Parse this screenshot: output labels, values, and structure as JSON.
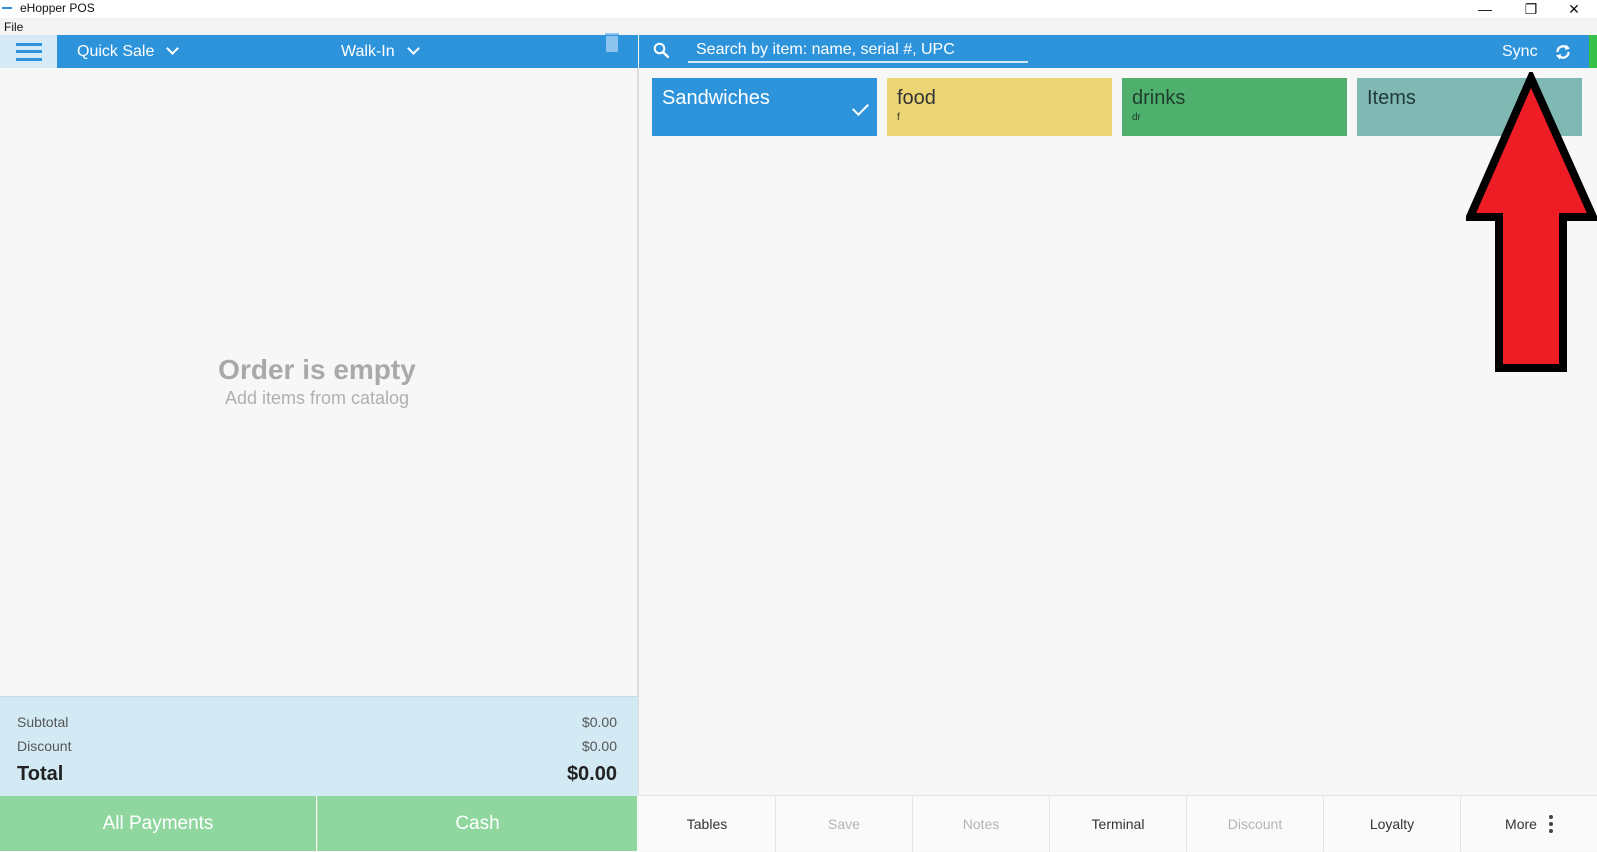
{
  "window": {
    "title": "eHopper POS",
    "menu_file": "File",
    "min_glyph": "—",
    "max_glyph": "❐",
    "close_glyph": "✕"
  },
  "header": {
    "order_type": "Quick Sale",
    "customer": "Walk-In",
    "search_placeholder": "Search by item: name, serial #, UPC",
    "sync_label": "Sync"
  },
  "order": {
    "empty_title": "Order is empty",
    "empty_subtitle": "Add items from catalog"
  },
  "totals": {
    "subtotal_label": "Subtotal",
    "subtotal_value": "$0.00",
    "discount_label": "Discount",
    "discount_value": "$0.00",
    "total_label": "Total",
    "total_value": "$0.00"
  },
  "payments": {
    "all_payments": "All Payments",
    "cash": "Cash"
  },
  "categories": [
    {
      "name": "Sandwiches",
      "sub": "",
      "color": "#2d94dc",
      "text_color": "#ffffff",
      "selected": true
    },
    {
      "name": "food",
      "sub": "f",
      "color": "#ecd574",
      "text_color": "#333333",
      "selected": false
    },
    {
      "name": "drinks",
      "sub": "dr",
      "color": "#4fb06e",
      "text_color": "#1f3d2a",
      "selected": false
    },
    {
      "name": "Items",
      "sub": "",
      "color": "#80b8b3",
      "text_color": "#213938",
      "selected": false
    }
  ],
  "bottom_actions": [
    {
      "label": "Tables",
      "enabled": true
    },
    {
      "label": "Save",
      "enabled": false
    },
    {
      "label": "Notes",
      "enabled": false
    },
    {
      "label": "Terminal",
      "enabled": true
    },
    {
      "label": "Discount",
      "enabled": false
    },
    {
      "label": "Loyalty",
      "enabled": true
    },
    {
      "label": "More",
      "enabled": true
    }
  ],
  "colors": {
    "accent": "#2d94dc",
    "pay_green": "#8fd79f",
    "totals_bg": "#d3eaf4",
    "annotation_arrow": "#ee1c25"
  }
}
